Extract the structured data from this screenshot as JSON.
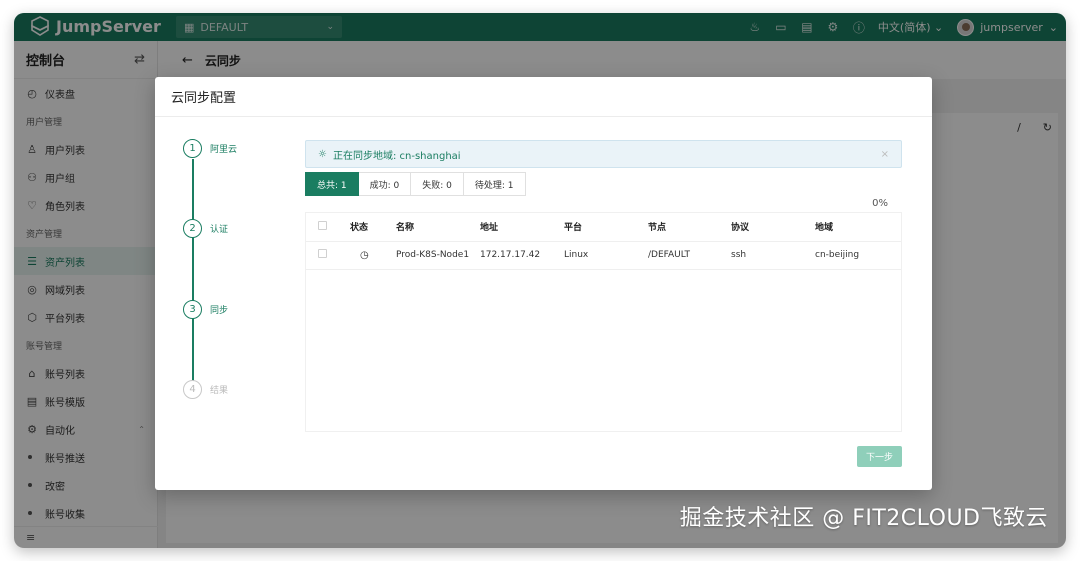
{
  "topbar": {
    "brand": "JumpServer",
    "org": "DEFAULT",
    "lang": "中文(简体)",
    "username": "jumpserver"
  },
  "sidebar": {
    "title": "控制台",
    "items": [
      {
        "type": "item",
        "label": "仪表盘",
        "icon": "dashboard-icon"
      },
      {
        "type": "group",
        "label": "用户管理"
      },
      {
        "type": "item",
        "label": "用户列表",
        "icon": "user-icon"
      },
      {
        "type": "item",
        "label": "用户组",
        "icon": "users-icon"
      },
      {
        "type": "item",
        "label": "角色列表",
        "icon": "role-icon"
      },
      {
        "type": "group",
        "label": "资产管理"
      },
      {
        "type": "item",
        "label": "资产列表",
        "icon": "asset-icon",
        "active": true
      },
      {
        "type": "item",
        "label": "网域列表",
        "icon": "domain-icon"
      },
      {
        "type": "item",
        "label": "平台列表",
        "icon": "platform-icon"
      },
      {
        "type": "group",
        "label": "账号管理"
      },
      {
        "type": "item",
        "label": "账号列表",
        "icon": "lock-icon"
      },
      {
        "type": "item",
        "label": "账号模版",
        "icon": "template-icon"
      },
      {
        "type": "item",
        "label": "自动化",
        "icon": "automation-icon",
        "expanded": true
      },
      {
        "type": "sub",
        "label": "账号推送"
      },
      {
        "type": "sub",
        "label": "改密"
      },
      {
        "type": "sub",
        "label": "账号收集"
      }
    ]
  },
  "page": {
    "title": "云同步",
    "bg_sep": "/"
  },
  "dialog": {
    "title": "云同步配置",
    "steps": [
      {
        "num": "1",
        "label": "阿里云",
        "state": "done"
      },
      {
        "num": "2",
        "label": "认证",
        "state": "done"
      },
      {
        "num": "3",
        "label": "同步",
        "state": "current"
      },
      {
        "num": "4",
        "label": "结果",
        "state": "pending"
      }
    ],
    "alert": "正在同步地域: cn-shanghai",
    "tabs": [
      {
        "label": "总共: 1",
        "active": true
      },
      {
        "label": "成功: 0",
        "active": false
      },
      {
        "label": "失败: 0",
        "active": false
      },
      {
        "label": "待处理: 1",
        "active": false
      }
    ],
    "progress": 0,
    "progress_text": "0%",
    "columns": [
      "状态",
      "名称",
      "地址",
      "平台",
      "节点",
      "协议",
      "地域"
    ],
    "rows": [
      {
        "name": "Prod-K8S-Node1",
        "address": "172.17.17.42",
        "platform": "Linux",
        "node": "/DEFAULT",
        "protocol": "ssh",
        "region": "cn-beijing"
      }
    ],
    "next_label": "下一步"
  },
  "watermark": "掘金技术社区 @ FIT2CLOUD飞致云",
  "colors": {
    "brand": "#1a7d61",
    "next_button": "#8fcfba"
  }
}
